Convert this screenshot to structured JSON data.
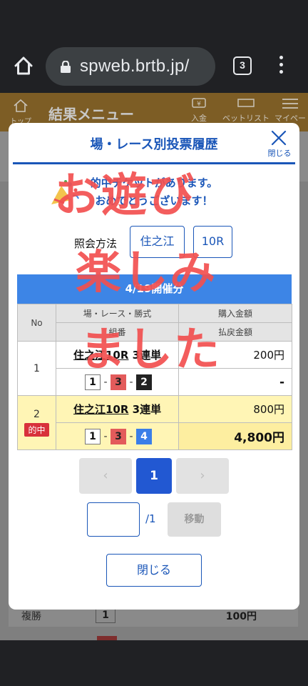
{
  "browser": {
    "url": "spweb.brtb.jp/",
    "tab_count": "3"
  },
  "site_header": {
    "title": "結果メニュー",
    "home_label": "トップ",
    "nav": [
      "入金",
      "ベットリスト",
      "マイページ"
    ]
  },
  "background_rows": [
    {
      "label": "複勝",
      "box": "1",
      "price": "100円"
    }
  ],
  "modal": {
    "title": "場・レース別投票履歴",
    "close_label": "閉じる",
    "win_message_line1": "的中チケットがあります。",
    "win_message_line2": "おめでとうございます！",
    "query_label": "照会方法",
    "query_place": "住之江",
    "query_race": "10R",
    "date_header": "4/19開催分",
    "table": {
      "col_no": "No",
      "col_race": "場・レース・勝式",
      "col_combo": "組番",
      "col_purchase": "購入金額",
      "col_payout": "払戻金額",
      "rows": [
        {
          "no": "1",
          "place_race": "住之江10R",
          "bet_type": "3連単",
          "combo": [
            "1",
            "3",
            "2"
          ],
          "purchase": "200円",
          "payout": "-",
          "hit": false
        },
        {
          "no": "2",
          "place_race": "住之江10R",
          "bet_type": "3連単",
          "combo": [
            "1",
            "3",
            "4"
          ],
          "purchase": "800円",
          "payout": "4,800円",
          "hit": true,
          "hit_label": "的中"
        }
      ]
    },
    "pagination": {
      "prev": "‹",
      "current": "1",
      "next": "›",
      "jump_value": "",
      "total": "/1",
      "jump_button": "移動"
    },
    "close_button": "閉じる"
  },
  "overlay": {
    "line1": "お遊び",
    "line2": "楽しみ",
    "line3": "ました"
  },
  "colors": {
    "accent_blue": "#1a56b8",
    "date_bar": "#3d85e6",
    "hit_bg": "#fff5b5",
    "overlay_red": "#f25050"
  }
}
